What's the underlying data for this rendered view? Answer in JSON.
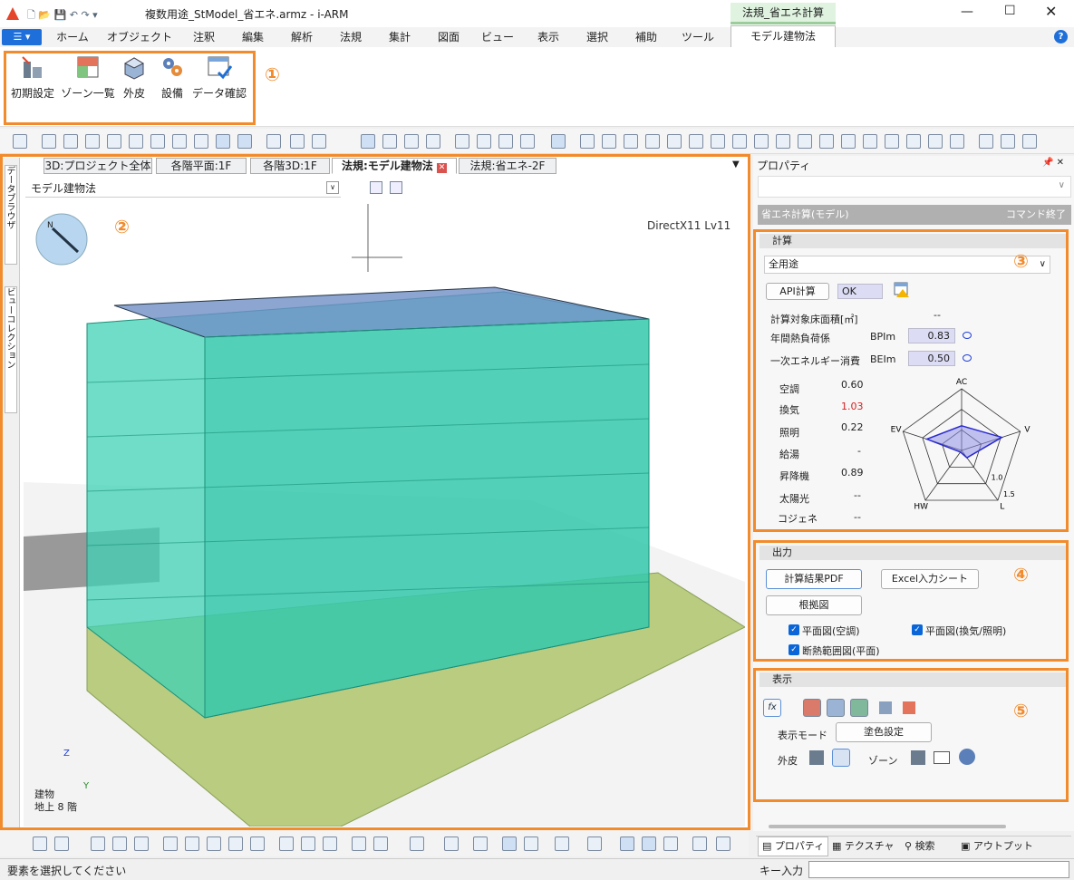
{
  "window": {
    "title": "複数用途_StModel_省エネ.armz - i-ARM",
    "context_tab": "法規_省エネ計算"
  },
  "menu_tabs": [
    "ホーム",
    "オブジェクト",
    "注釈",
    "編集",
    "解析",
    "法規",
    "集計",
    "図面",
    "ビュー",
    "表示",
    "選択",
    "補助",
    "ツール",
    "モデル建物法"
  ],
  "ribbon": [
    "初期設定",
    "ゾーン一覧",
    "外皮",
    "設備",
    "データ確認"
  ],
  "circled": [
    "①",
    "②",
    "③",
    "④",
    "⑤"
  ],
  "doc_tabs": [
    "3D:プロジェクト全体",
    "各階平面:1F",
    "各階3D:1F",
    "法規:モデル建物法",
    "法規:省エネ-2F"
  ],
  "view_select": "モデル建物法",
  "side_tabs": [
    "データブラウザ",
    "ビューコレクション"
  ],
  "viewport": {
    "renderer": "DirectX11 Lv11",
    "compass": "N",
    "axis_z": "Z",
    "axis_y": "Y",
    "layer_line1": "建物",
    "layer_line2": "地上 8 階"
  },
  "panel": {
    "title": "プロパティ",
    "mode": "省エネ計算(モデル)",
    "end_cmd": "コマンド終了",
    "calc": {
      "header": "計算",
      "use": "全用途",
      "api_btn": "API計算",
      "ok": "OK",
      "floor_label": "計算対象床面積[㎡]",
      "floor_val": "--",
      "pal_label": "年間熱負荷係",
      "pal_code": "BPIm",
      "pal_val": "0.83",
      "bei_label": "一次エネルギー消費",
      "bei_code": "BEIm",
      "bei_val": "0.50",
      "rows": [
        {
          "k": "空調",
          "v": "0.60"
        },
        {
          "k": "換気",
          "v": "1.03"
        },
        {
          "k": "照明",
          "v": "0.22"
        },
        {
          "k": "給湯",
          "v": "-"
        },
        {
          "k": "昇降機",
          "v": "0.89"
        },
        {
          "k": "太陽光",
          "v": "--"
        },
        {
          "k": "コジェネ",
          "v": "--"
        }
      ],
      "radar": {
        "labels": [
          "AC",
          "V",
          "L",
          "HW",
          "EV"
        ],
        "ring1": "1.0",
        "ring2": "1.5",
        "values": [
          0.6,
          1.03,
          0.22,
          0,
          0.89
        ]
      }
    },
    "output": {
      "header": "出力",
      "pdf": "計算結果PDF",
      "excel": "Excel入力シート",
      "basis": "根拠図",
      "cb1": "平面図(空調)",
      "cb2": "平面図(換気/照明)",
      "cb3": "断熱範囲図(平面)"
    },
    "display": {
      "header": "表示",
      "mode_label": "表示モード",
      "color_btn": "塗色設定",
      "skin": "外皮",
      "zone": "ゾーン"
    },
    "bottom_tabs": [
      "プロパティ",
      "テクスチャ",
      "検索",
      "アウトプット"
    ]
  },
  "status": {
    "message": "要素を選択してください",
    "key_input": "キー入力"
  },
  "colors": {
    "accent": "#f28b2c",
    "building": "#3fd1b4",
    "ground": "#b9cc7f",
    "ribbon_active": "#1e6fd9"
  }
}
